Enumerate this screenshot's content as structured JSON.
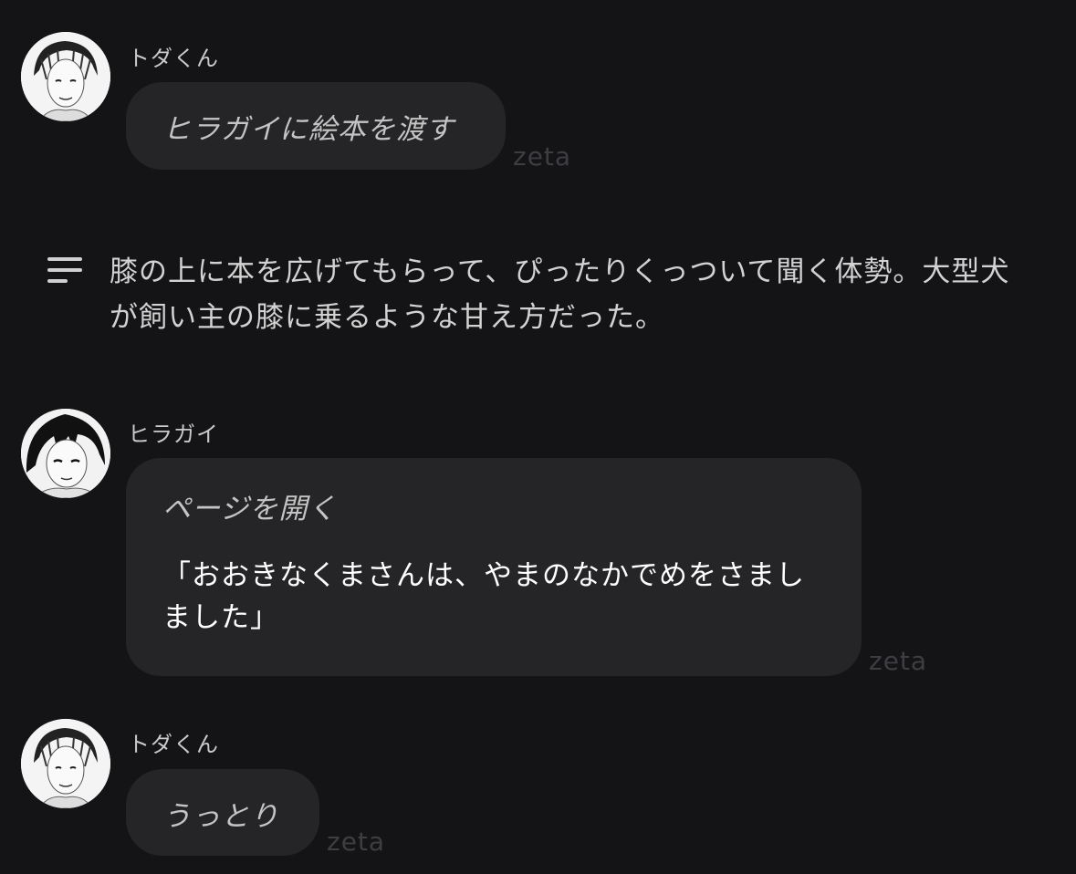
{
  "messages": [
    {
      "sender": "トダくん",
      "text": "ヒラガイに絵本を渡す",
      "watermark": "zeta",
      "avatar_icon": "avatar-todakun-icon"
    },
    {
      "sender": "ヒラガイ",
      "action": "ページを開く",
      "quote": "「おおきなくまさんは、やまのなかでめをさましました」",
      "watermark": "zeta",
      "avatar_icon": "avatar-hiragai-icon"
    },
    {
      "sender": "トダくん",
      "text": "うっとり",
      "watermark": "zeta",
      "avatar_icon": "avatar-todakun-icon"
    }
  ],
  "narration": {
    "icon": "menu-lines-icon",
    "text": "膝の上に本を広げてもらって、ぴったりくっついて聞く体勢。大型犬が飼い主の膝に乗るような甘え方だった。"
  },
  "colors": {
    "background": "#141416",
    "bubble": "#252527",
    "watermark": "#3e3e42"
  }
}
